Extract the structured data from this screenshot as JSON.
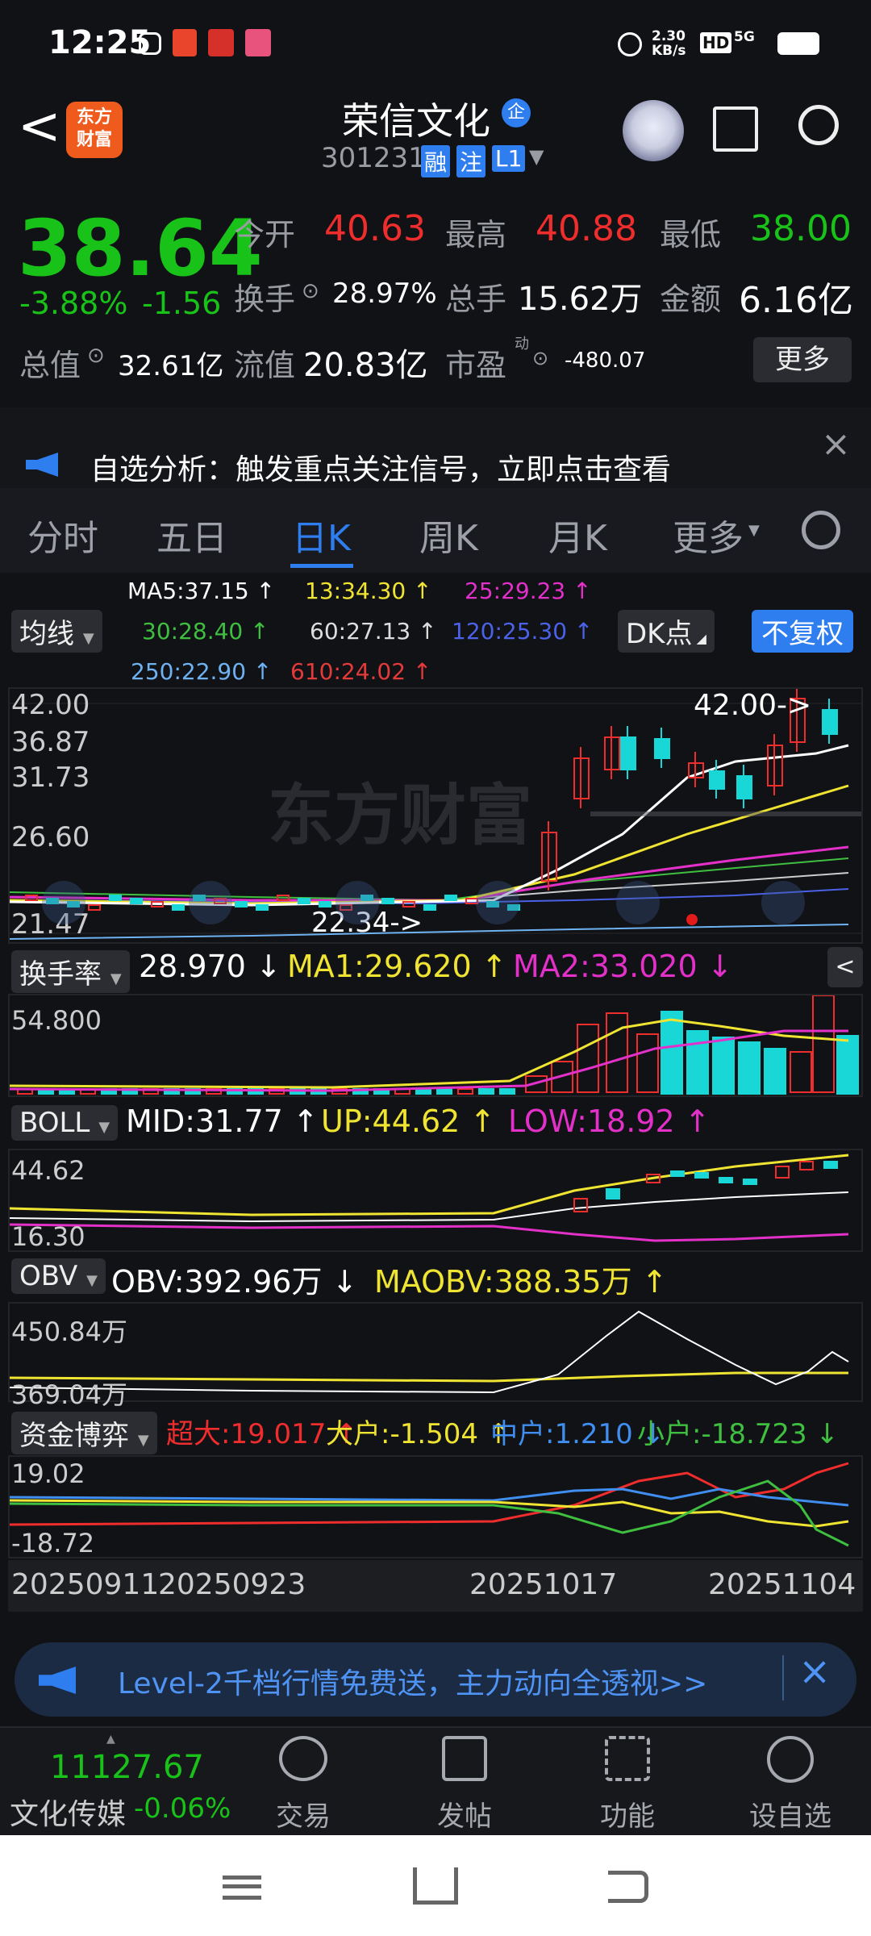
{
  "status_bar": {
    "time": "12:25",
    "net_speed": "2.30\nKB/s",
    "hd": "HD",
    "signal": "5G"
  },
  "header": {
    "back": "<",
    "logo_text": "东方\n财富",
    "stock_name": "荣信文化",
    "badge": "企",
    "code": "301231",
    "tags": [
      "融",
      "注",
      "L1"
    ]
  },
  "quote": {
    "price": "38.64",
    "change_pct": "-3.88%",
    "change": "-1.56",
    "open_label": "今开",
    "open": "40.63",
    "high_label": "最高",
    "high": "40.88",
    "low_label": "最低",
    "low": "38.00",
    "turnover_label": "换手",
    "turnover": "28.97%",
    "volume_label": "总手",
    "volume": "15.62万",
    "amount_label": "金额",
    "amount": "6.16亿",
    "total_value_label": "总值",
    "total_value": "32.61亿",
    "float_value_label": "流值",
    "float_value": "20.83亿",
    "pe_label": "市盈",
    "pe_sup": "动",
    "pe": "-480.07",
    "more_button": "更多"
  },
  "banner": {
    "text": "自选分析：触发重点关注信号，立即点击查看",
    "close": "×"
  },
  "tabs": [
    "分时",
    "五日",
    "日K",
    "周K",
    "月K",
    "更多"
  ],
  "active_tab": 2,
  "ma_row": {
    "selector": "均线",
    "ma5": "MA5:37.15 ↑",
    "ma13": "13:34.30 ↑",
    "ma25": "25:29.23 ↑",
    "ma30": "30:28.40 ↑",
    "ma60": "60:27.13 ↑",
    "ma120": "120:25.30 ↑",
    "ma250": "250:22.90 ↑",
    "ma610": "610:24.02 ↑",
    "dk_button": "DK点",
    "fq_button": "不复权"
  },
  "kline": {
    "axis_labels": [
      "42.00",
      "36.87",
      "31.73",
      "26.60",
      "21.47"
    ],
    "high_marker": "42.00->",
    "low_marker": "22.34->",
    "watermark": "东方财富"
  },
  "turnover_panel": {
    "selector": "换手率",
    "value": "28.970 ↓",
    "ma1": "MA1:29.620 ↑",
    "ma2": "MA2:33.020 ↓",
    "axis_top": "54.800"
  },
  "boll_panel": {
    "selector": "BOLL",
    "mid": "MID:31.77 ↑",
    "up": "UP:44.62 ↑",
    "low": "LOW:18.92 ↑",
    "axis_top": "44.62",
    "axis_bottom": "16.30"
  },
  "obv_panel": {
    "selector": "OBV",
    "obv": "OBV:392.96万 ↓",
    "maobv": "MAOBV:388.35万 ↑",
    "axis_top": "450.84万",
    "axis_bottom": "369.04万"
  },
  "fund_panel": {
    "selector": "资金博弈",
    "super": "超大:19.017 ↑",
    "large": "大户:-1.504 ↑",
    "medium": "中户:1.210 ↓",
    "small": "小户:-18.723 ↓",
    "axis_top": "19.02",
    "axis_bottom": "-18.72"
  },
  "date_axis": [
    "20250911",
    "20250923",
    "20251017",
    "20251104"
  ],
  "ad": {
    "text": "Level-2千档行情免费送，主力动向全透视>>",
    "close": "×"
  },
  "bottom_nav": {
    "index_value": "11127.67",
    "index_name": "文化传媒",
    "index_change": "-0.06%",
    "items": [
      "交易",
      "发帖",
      "功能",
      "设自选"
    ]
  },
  "colors": {
    "up": "#ef2d2d",
    "down": "#19c219",
    "accent": "#2e7ef0",
    "candle_down": "#19d7d7"
  }
}
